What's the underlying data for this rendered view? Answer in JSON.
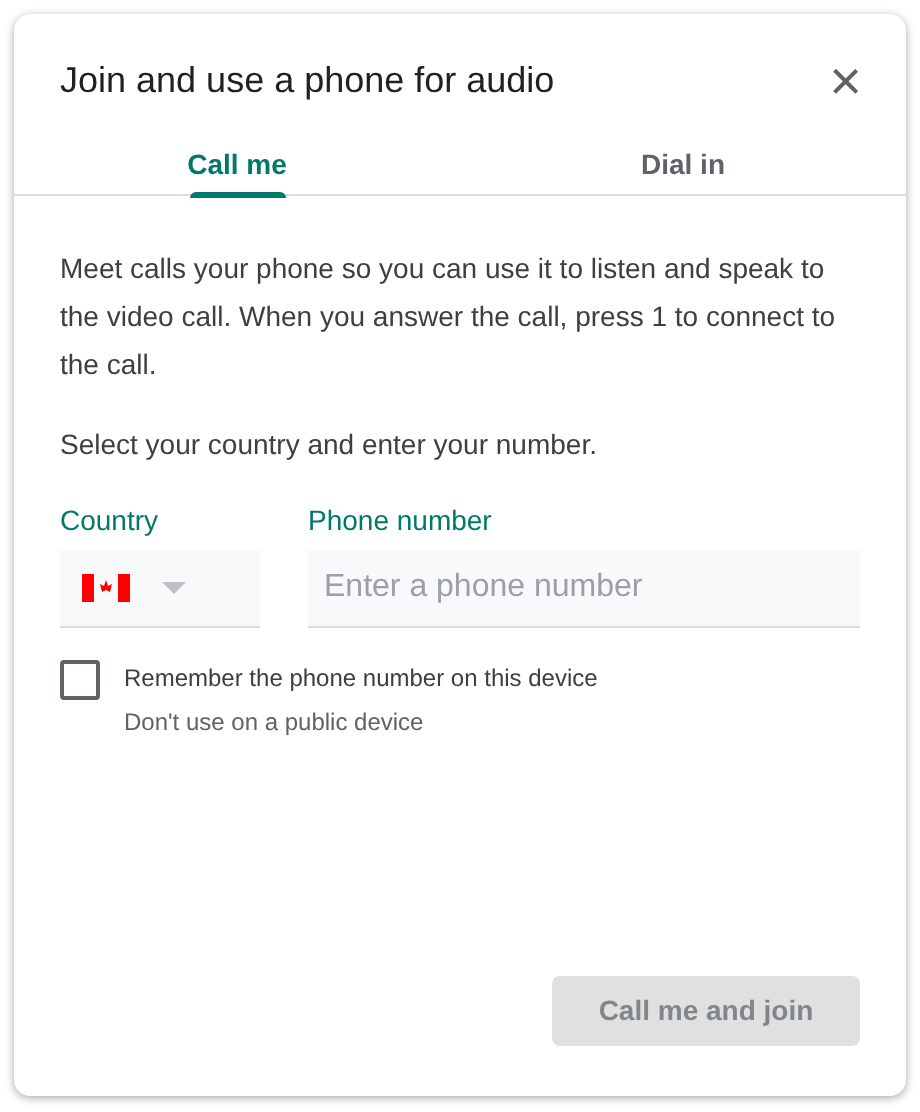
{
  "dialog": {
    "title": "Join and use a phone for audio",
    "close": "×"
  },
  "tabs": [
    {
      "label": "Call me",
      "selected": true
    },
    {
      "label": "Dial in",
      "selected": false
    }
  ],
  "description": "Meet calls your phone so you can use it to listen and speak to the video call. When you answer the call, press 1 to connect to the call.",
  "instruction": "Select your country and enter your number.",
  "country": {
    "label": "Country"
  },
  "phone": {
    "label": "Phone number",
    "placeholder": "Enter a phone number"
  },
  "remember": {
    "label": "Remember the phone number on this device",
    "hint": "Don't use on a public device",
    "checked": false
  },
  "submit": {
    "label": "Call me and join",
    "disabled": true
  }
}
